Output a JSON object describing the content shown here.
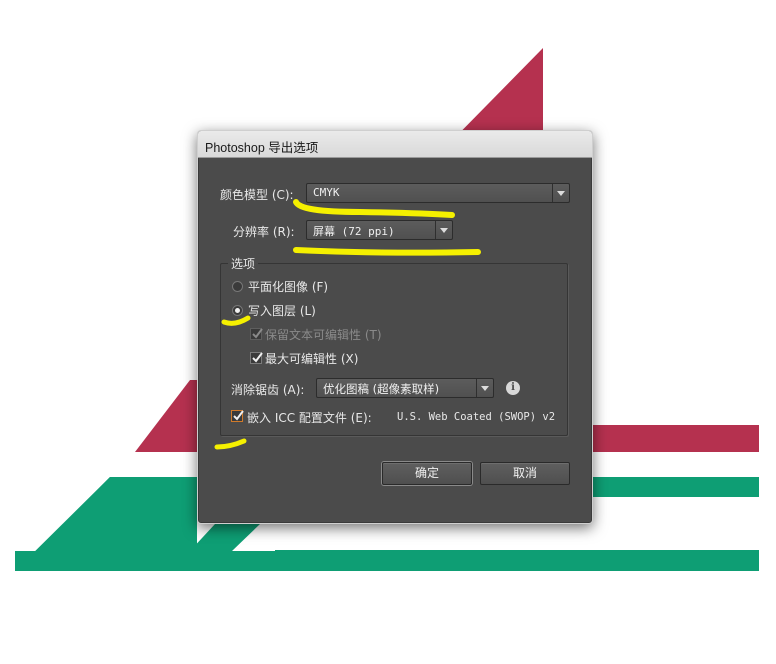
{
  "colors": {
    "crimson": "#b5314f",
    "green": "#0e9e74",
    "dialog_bg": "#4b4b4b",
    "highlight": "#f5f000"
  },
  "dialog": {
    "title": "Photoshop 导出选项",
    "color_model": {
      "label": "颜色模型 (C):",
      "value": "CMYK"
    },
    "resolution": {
      "label": "分辨率 (R):",
      "value": "屏幕 (72 ppi)"
    },
    "options": {
      "group_title": "选项",
      "flat_image": {
        "label": "平面化图像 (F)",
        "selected": false
      },
      "write_layers": {
        "label": "写入图层 (L)",
        "selected": true
      },
      "preserve_text": {
        "label": "保留文本可编辑性 (T)",
        "checked": true,
        "enabled": false
      },
      "max_editability": {
        "label": "最大可编辑性 (X)",
        "checked": true
      },
      "anti_alias": {
        "label": "消除锯齿 (A):",
        "value": "优化图稿 (超像素取样)",
        "info_icon": "info-icon"
      },
      "embed_icc": {
        "label": "嵌入 ICC 配置文件 (E):",
        "profile": "U.S. Web Coated (SWOP) v2",
        "checked": true
      }
    },
    "ok_label": "确定",
    "cancel_label": "取消"
  }
}
